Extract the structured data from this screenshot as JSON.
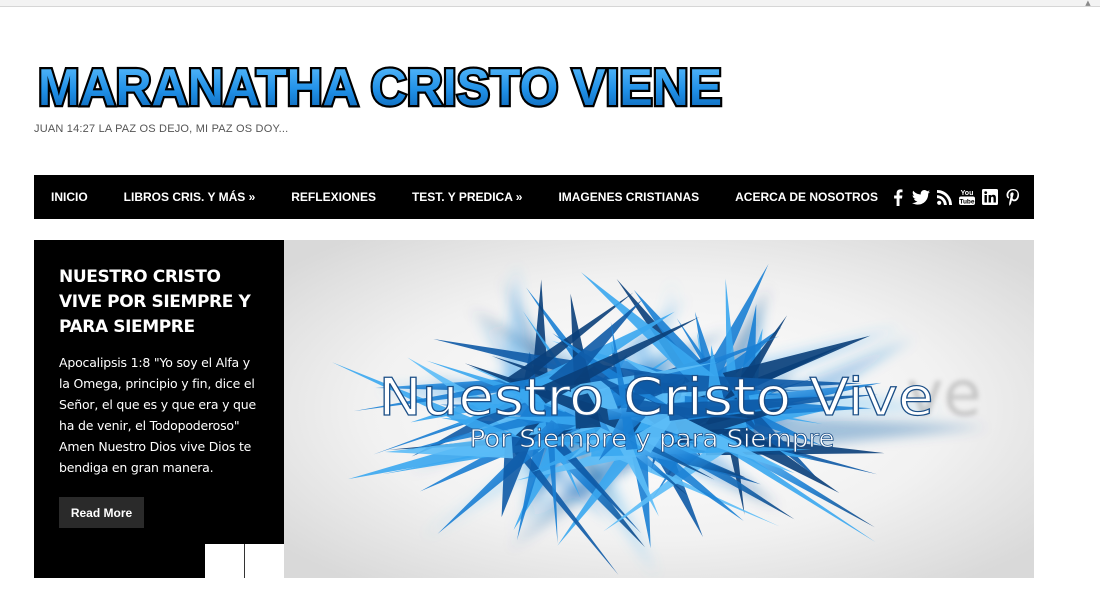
{
  "site": {
    "title": "MARANATHA CRISTO VIENE",
    "tagline": "JUAN 14:27 LA PAZ OS DEJO, MI PAZ OS DOY..."
  },
  "nav": {
    "items": [
      {
        "label": "INICIO"
      },
      {
        "label": "LIBROS CRIS. Y MÁS »"
      },
      {
        "label": "REFLEXIONES"
      },
      {
        "label": "TEST. Y PREDICA »"
      },
      {
        "label": "IMAGENES CRISTIANAS"
      },
      {
        "label": "ACERCA DE NOSOTROS"
      }
    ],
    "social_icons": [
      "facebook-icon",
      "twitter-icon",
      "rss-icon",
      "youtube-icon",
      "linkedin-icon",
      "pinterest-icon"
    ]
  },
  "featured": {
    "title": "NUESTRO CRISTO VIVE POR SIEMPRE Y PARA SIEMPRE",
    "excerpt": "Apocalipsis 1:8 \"Yo soy el Alfa y la Omega, principio y fin, dice el Señor, el que es y que era y que ha de venir, el Todopoderoso\" Amen Nuestro Dios vive Dios te bendiga en gran manera.",
    "read_more_label": "Read More",
    "image": {
      "headline": "Nuestro Cristo Vive",
      "subline": "Por Siempre y para Siempre"
    }
  },
  "colors": {
    "nav_background": "#000000",
    "logo_blue": "#1f8fe6",
    "slide_accent_blue": "#1a7fd4"
  }
}
